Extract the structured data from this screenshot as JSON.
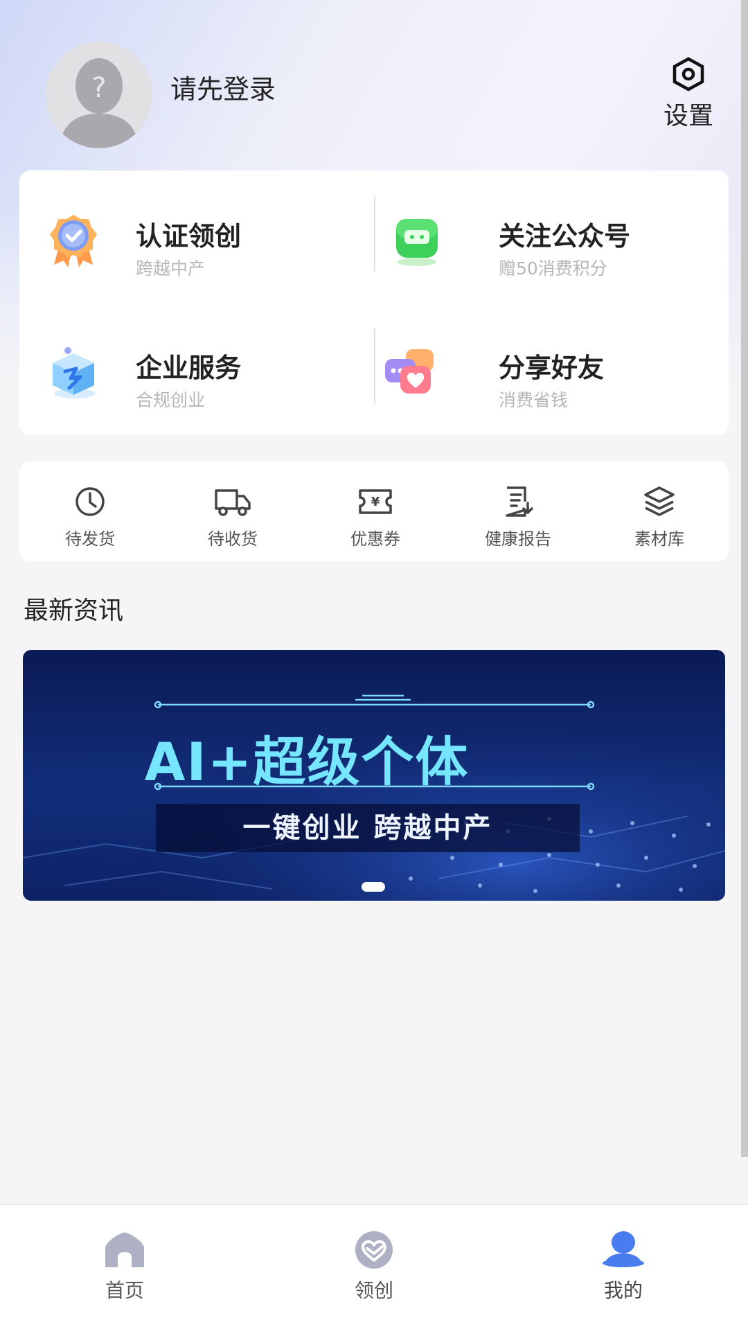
{
  "header": {
    "login_prompt": "请先登录",
    "settings_label": "设置"
  },
  "features": [
    {
      "title": "认证领创",
      "subtitle": "跨越中产",
      "icon": "certified-badge-icon"
    },
    {
      "title": "关注公众号",
      "subtitle": "赠50消费积分",
      "icon": "wechat-chat-icon"
    },
    {
      "title": "企业服务",
      "subtitle": "合规创业",
      "icon": "enterprise-cube-icon"
    },
    {
      "title": "分享好友",
      "subtitle": "消费省钱",
      "icon": "share-hearts-icon"
    }
  ],
  "quick_actions": [
    {
      "label": "待发货",
      "icon": "clock-icon"
    },
    {
      "label": "待收货",
      "icon": "truck-icon"
    },
    {
      "label": "优惠券",
      "icon": "coupon-icon"
    },
    {
      "label": "健康报告",
      "icon": "report-icon"
    },
    {
      "label": "素材库",
      "icon": "layers-icon"
    }
  ],
  "news": {
    "section_title": "最新资讯",
    "banner_title": "AI+超级个体",
    "banner_subtitle": "一键创业  跨越中产",
    "carousel_index": 1,
    "carousel_total": 1
  },
  "tabbar": {
    "active": 2,
    "items": [
      {
        "label": "首页",
        "icon": "home-icon"
      },
      {
        "label": "领创",
        "icon": "lingchuang-heart-icon"
      },
      {
        "label": "我的",
        "icon": "profile-icon"
      }
    ]
  },
  "colors": {
    "accent": "#4a7cf0",
    "banner_text": "#76e6ff",
    "inactive_icon": "#aeb0c4",
    "subtitle_gray": "#b6b6ba"
  }
}
